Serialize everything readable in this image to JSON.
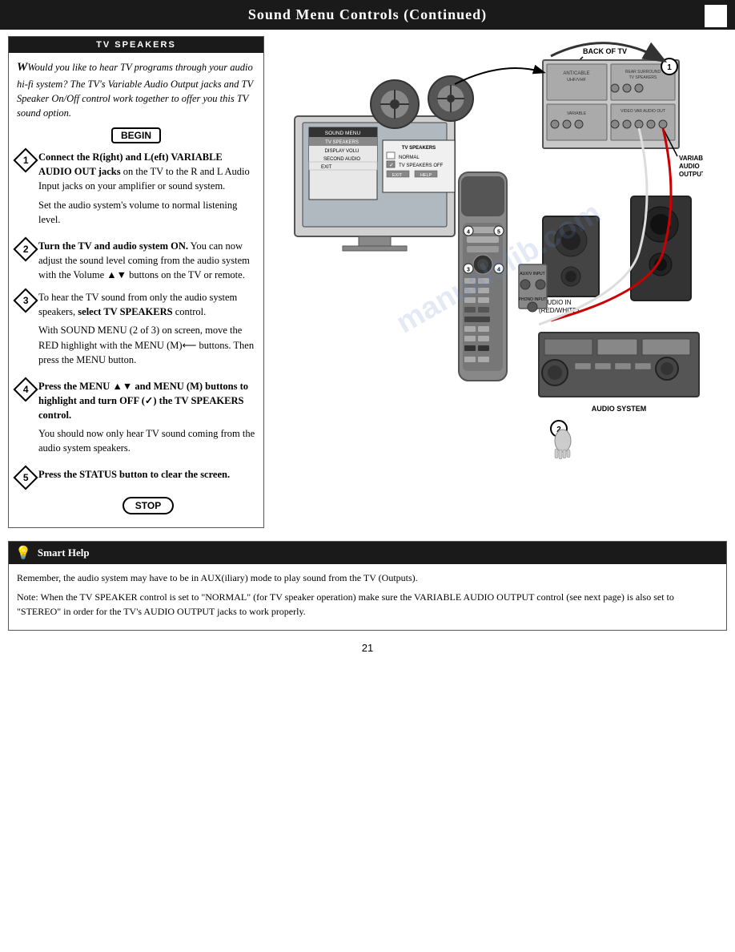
{
  "header": {
    "title": "Sound Menu Controls (Continued)",
    "box": ""
  },
  "left_panel": {
    "section_title": "TV SPEAKERS",
    "intro": "Would you like to hear TV programs through your audio hi-fi system? The TV's Variable Audio Output jacks and TV Speaker On/Off control work together to offer you this TV sound option.",
    "begin_label": "BEGIN",
    "steps": [
      {
        "num": "1",
        "type": "diamond",
        "heading": "Connect the R(ight) and L(eft) VARIABLE AUDIO OUT jacks",
        "text": "on the TV to the R and L Audio Input jacks on your amplifier or sound system.",
        "sub": "Set the audio system's volume to normal listening level."
      },
      {
        "num": "2",
        "type": "diamond",
        "heading": "Turn the TV and audio system ON.",
        "text": "You can now adjust the sound level coming from the audio system with the Volume ▲▼ buttons on the TV or remote."
      },
      {
        "num": "3",
        "type": "diamond",
        "heading": "To hear the TV sound from only the audio system speakers,",
        "text": "select TV SPEAKERS control.",
        "sub": "With SOUND MENU (2 of 3) on screen, move the RED highlight with the MENU (M)⟵ buttons. Then press the MENU button."
      },
      {
        "num": "4",
        "type": "diamond",
        "heading": "Press the MENU ▲▼ and MENU (M) buttons to highlight and turn OFF (✓) the TV SPEAKERS control.",
        "sub": "You should now only hear TV sound coming from the audio system speakers."
      },
      {
        "num": "5",
        "type": "diamond",
        "heading": "Press the STATUS button to clear the screen.",
        "sub": ""
      }
    ],
    "stop_label": "STOP"
  },
  "smart_help": {
    "title": "Smart Help",
    "lightbulb": "💡",
    "paragraphs": [
      "Remember, the audio system may have to be in AUX(iliary) mode to play sound from the TV (Outputs).",
      "Note: When the TV SPEAKER control is set to \"NORMAL\" (for TV speaker operation) make sure the VARIABLE AUDIO OUTPUT control (see next page) is also set to \"STEREO\" in order for the TV's AUDIO OUTPUT jacks to work properly."
    ]
  },
  "diagram": {
    "labels": {
      "back_of_tv": "BACK OF TV",
      "variable_audio_output_jacks": "VARIABLE\nAUDIO\nOUTPUT JACKS",
      "audio_in": "AUDIO IN\n(RED/WHITE)",
      "audio_system": "AUDIO SYSTEM",
      "step1_num": "1",
      "step2_num": "2",
      "step3_num": "3",
      "step4_num": "4",
      "step5_num": "5"
    },
    "menu_items": [
      "SOUND MENU",
      "TV SPEAKERS",
      "DISPLAY VOLU",
      "SECOND AUDIO",
      "EXIT"
    ],
    "tv_speakers_menu": {
      "header": "TV SPEAKERS",
      "normal": "NORMAL",
      "tv_speakers_off": "TV SPEAKERS OFF",
      "exit": "EXIT",
      "help": "HELP"
    }
  },
  "page_num": "21",
  "watermark": "manualslib.com"
}
